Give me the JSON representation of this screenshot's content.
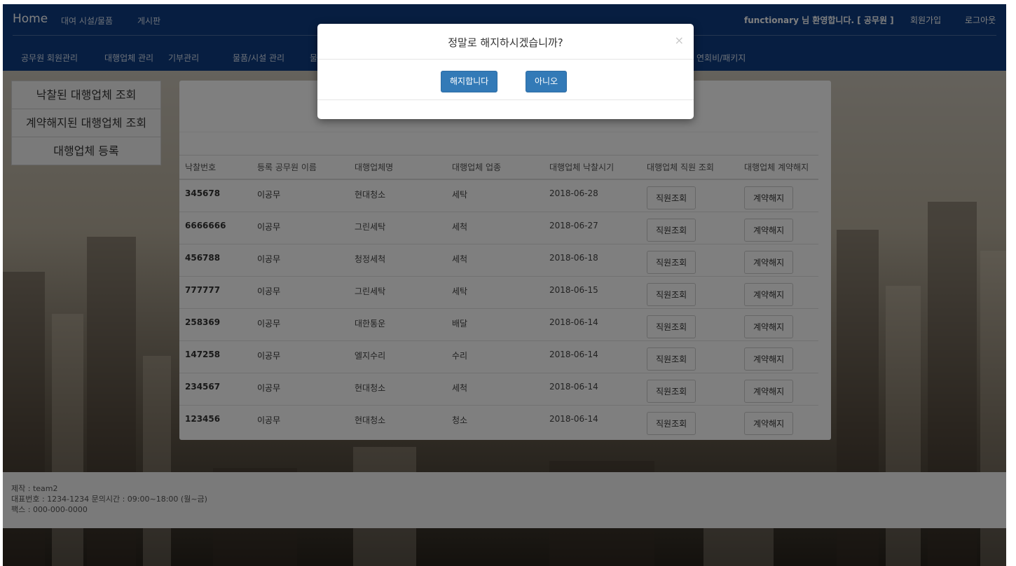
{
  "nav": {
    "home": "Home",
    "top_links": [
      "대여 시설/물품",
      "게시판"
    ],
    "welcome": "functionary 님 환영합니다. [ 공무원 ]",
    "signup": "회원가입",
    "logout": "로그아웃",
    "sub_links": [
      "공무원 회원관리",
      "대행업체 관리",
      "기부관리",
      "물품/시설 관리",
      "물",
      "연회비/패키지"
    ]
  },
  "side_menu": [
    "낙찰된 대행업체 조회",
    "계약해지된 대행업체 조회",
    "대행업체 등록"
  ],
  "table": {
    "headers": [
      "낙찰번호",
      "등록 공무원 이름",
      "대행업체명",
      "대행업체 업종",
      "대행업체 낙찰시기",
      "대행업체 직원 조회",
      "대행업체 계약해지"
    ],
    "view_label": "직원조회",
    "cancel_label": "계약해지",
    "rows": [
      {
        "id": "345678",
        "officer": "이공무",
        "company": "현대청소",
        "type": "세탁",
        "date": "2018-06-28"
      },
      {
        "id": "6666666",
        "officer": "이공무",
        "company": "그린세탁",
        "type": "세척",
        "date": "2018-06-27"
      },
      {
        "id": "456788",
        "officer": "이공무",
        "company": "청정세척",
        "type": "세척",
        "date": "2018-06-18"
      },
      {
        "id": "777777",
        "officer": "이공무",
        "company": "그린세탁",
        "type": "세탁",
        "date": "2018-06-15"
      },
      {
        "id": "258369",
        "officer": "이공무",
        "company": "대한통운",
        "type": "배달",
        "date": "2018-06-14"
      },
      {
        "id": "147258",
        "officer": "이공무",
        "company": "엘지수리",
        "type": "수리",
        "date": "2018-06-14"
      },
      {
        "id": "234567",
        "officer": "이공무",
        "company": "현대청소",
        "type": "세척",
        "date": "2018-06-14"
      },
      {
        "id": "123456",
        "officer": "이공무",
        "company": "현대청소",
        "type": "청소",
        "date": "2018-06-14"
      }
    ]
  },
  "footer": {
    "line1": "제작 : team2",
    "line2": "대표번호 : 1234-1234 문의시간 : 09:00~18:00 (월~금)",
    "line3": "팩스 : 000-000-0000"
  },
  "modal": {
    "title": "정말로 해지하시겠습니까?",
    "close": "×",
    "confirm": "해지합니다",
    "cancel": "아니오"
  }
}
